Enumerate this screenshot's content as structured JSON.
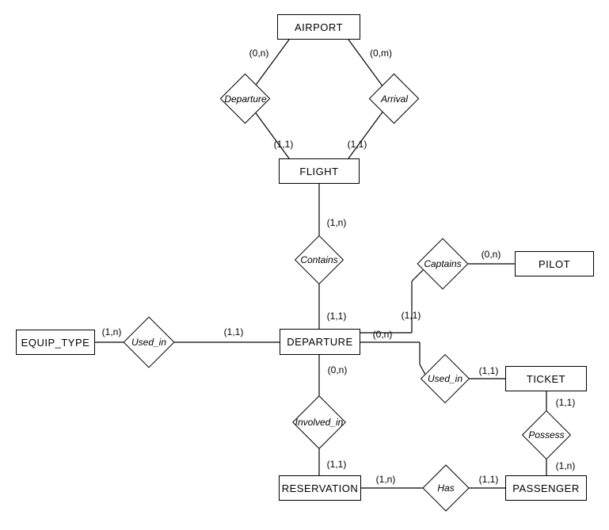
{
  "chart_data": {
    "type": "er-diagram",
    "entities": [
      "AIRPORT",
      "FLIGHT",
      "DEPARTURE",
      "EQUIP_TYPE",
      "PILOT",
      "TICKET",
      "RESERVATION",
      "PASSENGER"
    ],
    "relationships": [
      {
        "name": "Departure",
        "between": [
          "AIRPORT",
          "FLIGHT"
        ],
        "cardinality": [
          "(0,n)",
          "(1,1)"
        ]
      },
      {
        "name": "Arrival",
        "between": [
          "AIRPORT",
          "FLIGHT"
        ],
        "cardinality": [
          "(0,m)",
          "(1,1)"
        ]
      },
      {
        "name": "Contains",
        "between": [
          "FLIGHT",
          "DEPARTURE"
        ],
        "cardinality": [
          "(1,n)",
          "(1,1)"
        ]
      },
      {
        "name": "Used_in",
        "between": [
          "EQUIP_TYPE",
          "DEPARTURE"
        ],
        "cardinality": [
          "(1,n)",
          "(1,1)"
        ]
      },
      {
        "name": "Captains",
        "between": [
          "PILOT",
          "DEPARTURE"
        ],
        "cardinality": [
          "(0,n)",
          "(1,1)"
        ]
      },
      {
        "name": "Used_in",
        "between": [
          "DEPARTURE",
          "TICKET"
        ],
        "cardinality": [
          "(0,n)",
          "(1,1)"
        ]
      },
      {
        "name": "Involved_in",
        "between": [
          "DEPARTURE",
          "RESERVATION"
        ],
        "cardinality": [
          "(0,n)",
          "(1,1)"
        ]
      },
      {
        "name": "Has",
        "between": [
          "RESERVATION",
          "PASSENGER"
        ],
        "cardinality": [
          "(1,n)",
          "(1,1)"
        ]
      },
      {
        "name": "Possess",
        "between": [
          "TICKET",
          "PASSENGER"
        ],
        "cardinality": [
          "(1,1)",
          "(1,n)"
        ]
      }
    ]
  },
  "entities": {
    "airport": "AIRPORT",
    "flight": "FLIGHT",
    "departure": "DEPARTURE",
    "equip_type": "EQUIP_TYPE",
    "pilot": "PILOT",
    "ticket": "TICKET",
    "reservation": "RESERVATION",
    "passenger": "PASSENGER"
  },
  "relationships": {
    "dep": "Departure",
    "arr": "Arrival",
    "contains": "Contains",
    "used_in_eq": "Used_in",
    "captains": "Captains",
    "used_in_ticket": "Used_in",
    "involved_in": "Involved_in",
    "has": "Has",
    "possess": "Possess"
  },
  "card": {
    "airport_dep": "(0,n)",
    "airport_arr": "(0,m)",
    "flight_dep": "(1,1)",
    "flight_arr": "(1,1)",
    "flight_contains": "(1,n)",
    "departure_contains": "(1,1)",
    "equip_used": "(1,n)",
    "departure_used_eq": "(1,1)",
    "departure_captains": "(1,1)",
    "pilot_captains": "(0,n)",
    "departure_used_ticket": "(0,n)",
    "ticket_used": "(1,1)",
    "departure_involved": "(0,n)",
    "reservation_involved": "(1,1)",
    "reservation_has": "(1,n)",
    "passenger_has": "(1,1)",
    "ticket_possess": "(1,1)",
    "passenger_possess": "(1,n)"
  }
}
